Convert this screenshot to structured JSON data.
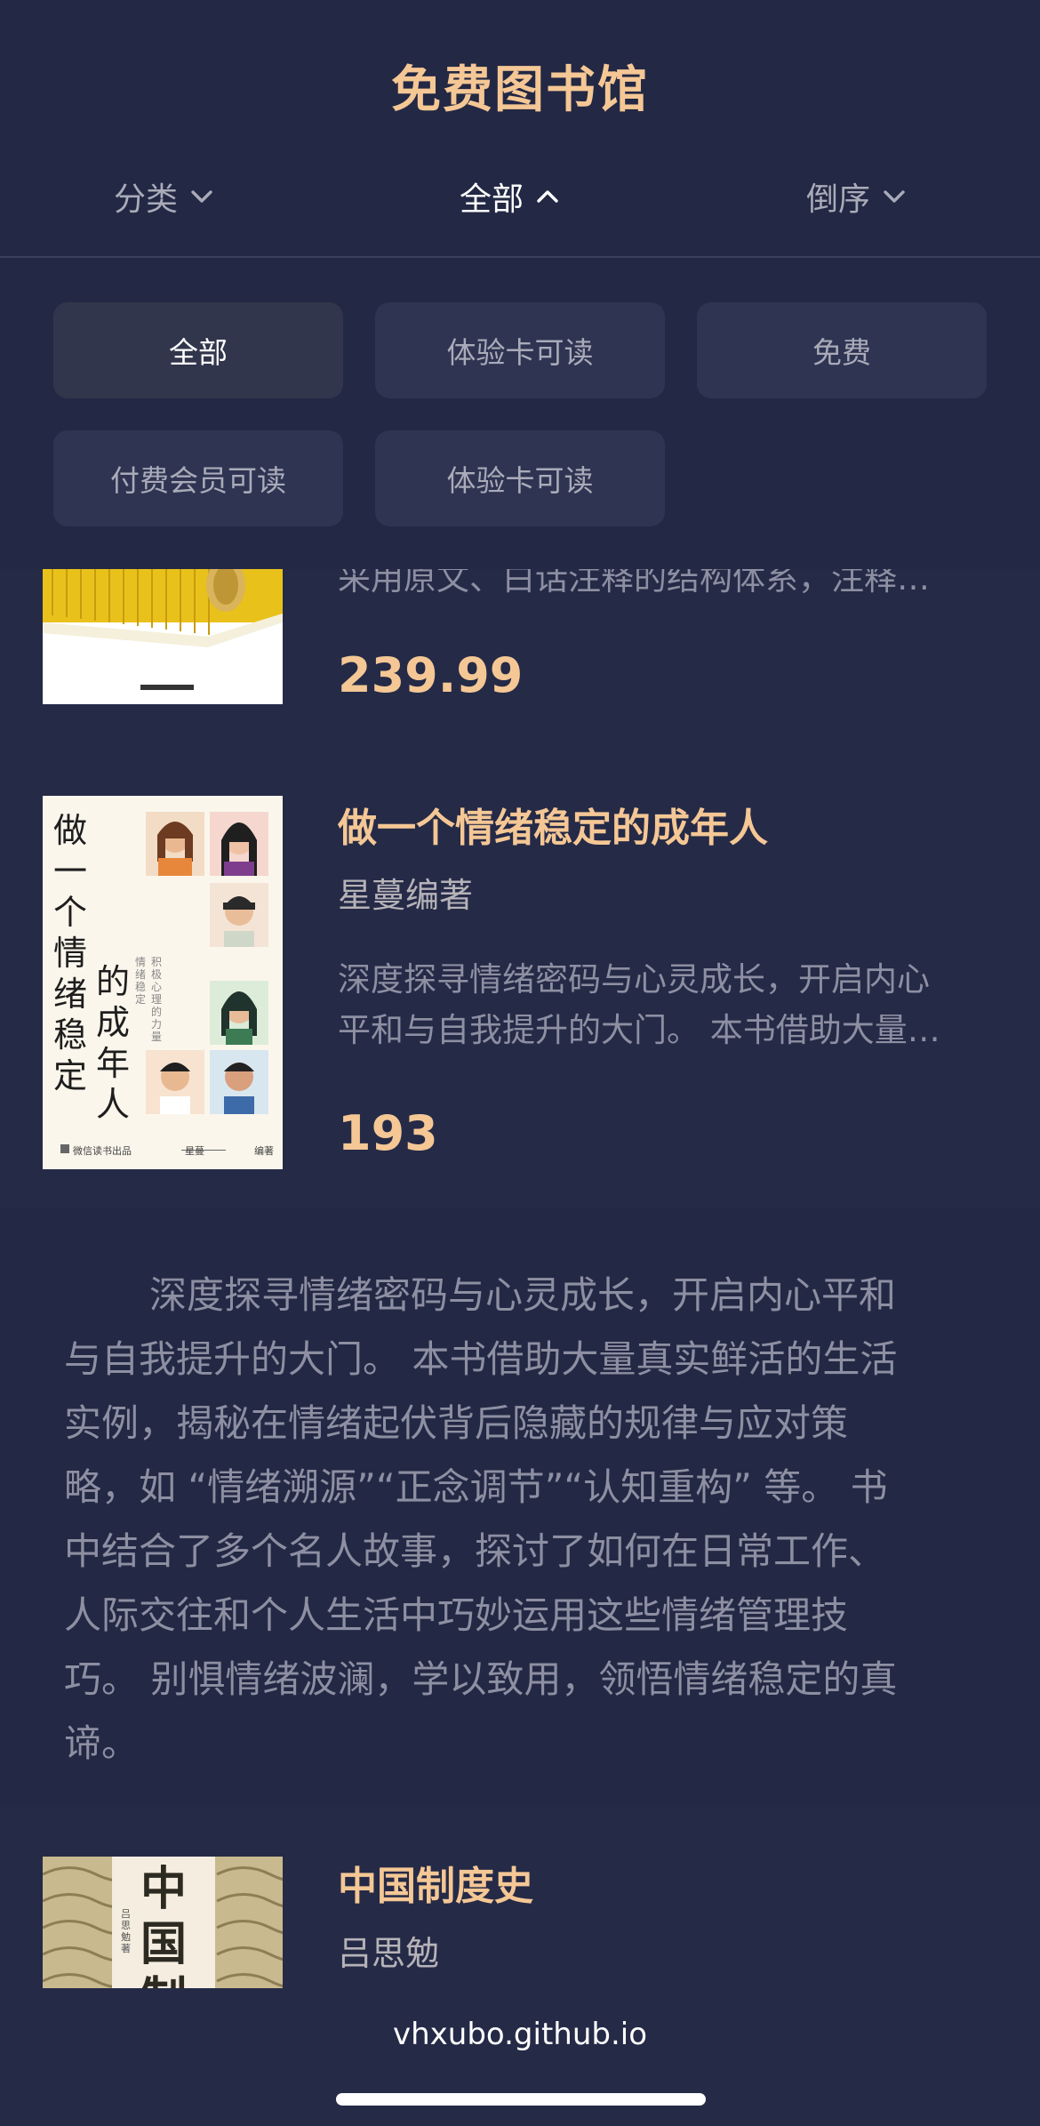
{
  "header": {
    "title": "免费图书馆"
  },
  "tabs": [
    {
      "label": "分类",
      "icon": "chevron-down-icon"
    },
    {
      "label": "全部",
      "icon": "chevron-up-icon"
    },
    {
      "label": "倒序",
      "icon": "chevron-down-icon"
    }
  ],
  "filter_options": [
    "全部",
    "体验卡可读",
    "免费",
    "付费会员可读",
    "体验卡可读"
  ],
  "books": [
    {
      "desc_visible": "采用原文、白话注释的结构体系，注释…",
      "price": "239.99"
    },
    {
      "title": "做一个情绪稳定的成年人",
      "author": "星蔓编著",
      "desc_lines": [
        "深度探寻情绪密码与心灵成长，开启内心",
        "平和与自我提升的大门。 本书借助大量…"
      ],
      "price": "193",
      "cover": {
        "big_text_a": "做一个情绪稳定",
        "big_text_b": "的成年人",
        "subtitle_a": "积极心理的力量",
        "subtitle_b": "情绪稳定",
        "publisher": "微信读书出品",
        "author_mark": "星蔓",
        "author_role": "编著"
      }
    },
    {
      "title": "中国制度史",
      "author": "吕思勉",
      "cover": {
        "big_text": "中国制",
        "side_text": "吕思勉 著"
      }
    }
  ],
  "expanded_description_lines": [
    "深度探寻情绪密码与心灵成长，开启内心平和",
    "与自我提升的大门。 本书借助大量真实鲜活的生活",
    "实例，揭秘在情绪起伏背后隐藏的规律与应对策",
    "略，如 “情绪溯源”“正念调节”“认知重构” 等。 书",
    "中结合了多个名人故事，探讨了如何在日常工作、",
    "人际交往和个人生活中巧妙运用这些情绪管理技",
    "巧。 别惧情绪波澜，学以致用，领悟情绪稳定的真",
    "谛。"
  ],
  "footer": {
    "url": "vhxubo.github.io"
  },
  "colors": {
    "background": "#222743",
    "accent_gold": "#f4c795",
    "muted_text": "#8d8fa2",
    "chip_bg": "#2f3452"
  }
}
